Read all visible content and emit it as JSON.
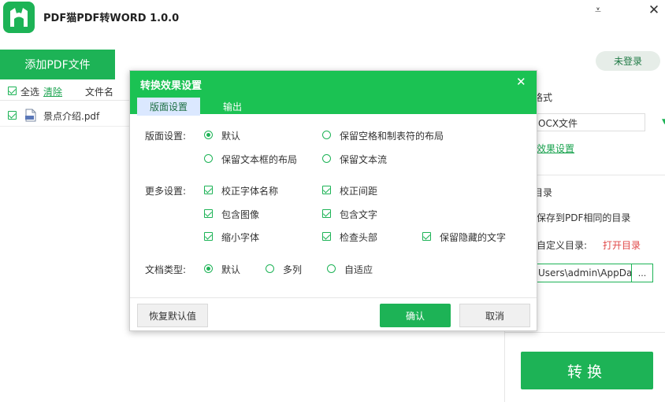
{
  "app": {
    "title": "PDF猫PDF转WORD 1.0.0",
    "minimize_glyph": "⩡",
    "close_glyph": "✕"
  },
  "toolbar": {
    "add_label": "添加PDF文件",
    "login_label": "未登录"
  },
  "file_list": {
    "select_all_label": "全选",
    "clear_label": "清除",
    "col_filename": "文件名",
    "files": [
      {
        "name": "景点介绍.pdf",
        "checked": true
      }
    ]
  },
  "right_panel": {
    "format_label": "格式",
    "format_value": "OCX文件",
    "effect_link": "效果设置",
    "output_label": "目录",
    "same_dir_label": "保存到PDF相同的目录",
    "custom_dir_label": "自定义目录:",
    "open_dir_link": "打开目录",
    "path_value": "Users\\admin\\AppDa",
    "browse_label": "...",
    "convert_label": "转换"
  },
  "dialog": {
    "title": "转换效果设置",
    "close_glyph": "✕",
    "tabs": [
      "版面设置",
      "输出"
    ],
    "layout": {
      "label": "版面设置:",
      "options": [
        "默认",
        "保留空格和制表符的布局",
        "保留文本框的布局",
        "保留文本流"
      ],
      "selected": "默认"
    },
    "more": {
      "label": "更多设置:",
      "options": [
        "校正字体名称",
        "校正间距",
        "包含图像",
        "包含文字",
        "缩小字体",
        "检查头部",
        "保留隐藏的文字"
      ]
    },
    "doc_type": {
      "label": "文档类型:",
      "options": [
        "默认",
        "多列",
        "自适应"
      ],
      "selected": "默认"
    },
    "buttons": {
      "reset": "恢复默认值",
      "ok": "确认",
      "cancel": "取消"
    }
  },
  "colors": {
    "brand_green": "#1db356",
    "dialog_header": "#1bc253",
    "tab_active_bg": "#dbe8ff",
    "link_red": "#e04848"
  }
}
